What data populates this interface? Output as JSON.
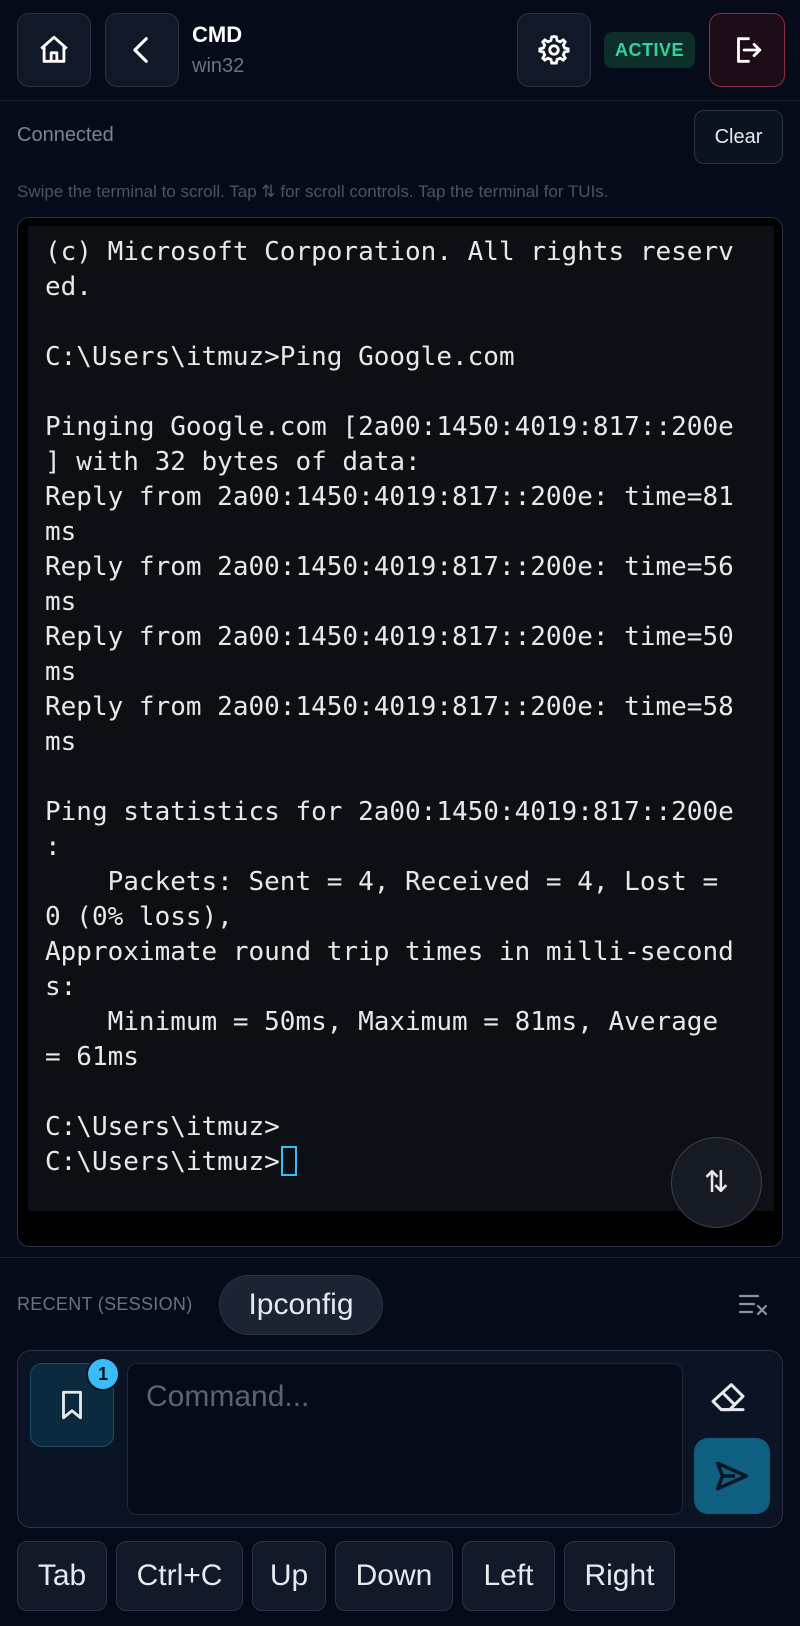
{
  "header": {
    "title": "CMD",
    "subtitle": "win32",
    "status": "ACTIVE",
    "icons": {
      "home": "home-icon",
      "back": "chevron-left-icon",
      "settings": "gear-icon",
      "exit": "logout-icon"
    }
  },
  "toolbar": {
    "connection_status": "Connected",
    "clear_label": "Clear",
    "hint": "Swipe the terminal to scroll. Tap ⇅ for scroll controls. Tap the terminal for TUIs."
  },
  "terminal": {
    "lines": [
      "(c) Microsoft Corporation. All rights reserv",
      "ed.",
      "",
      "C:\\Users\\itmuz>Ping Google.com",
      "",
      "Pinging Google.com [2a00:1450:4019:817::200e",
      "] with 32 bytes of data:",
      "Reply from 2a00:1450:4019:817::200e: time=81",
      "ms",
      "Reply from 2a00:1450:4019:817::200e: time=56",
      "ms",
      "Reply from 2a00:1450:4019:817::200e: time=50",
      "ms",
      "Reply from 2a00:1450:4019:817::200e: time=58",
      "ms",
      "",
      "Ping statistics for 2a00:1450:4019:817::200e",
      ":",
      "    Packets: Sent = 4, Received = 4, Lost =",
      "0 (0% loss),",
      "Approximate round trip times in milli-second",
      "s:",
      "    Minimum = 50ms, Maximum = 81ms, Average",
      "= 61ms",
      "",
      "C:\\Users\\itmuz>",
      "C:\\Users\\itmuz>"
    ],
    "scroll_icon": "⇅"
  },
  "recent": {
    "label": "RECENT (SESSION)",
    "items": [
      "Ipconfig"
    ]
  },
  "input": {
    "placeholder": "Command...",
    "value": "",
    "bookmark_count": "1"
  },
  "keys": [
    "Tab",
    "Ctrl+C",
    "Up",
    "Down",
    "Left",
    "Right"
  ],
  "colors": {
    "accent": "#38bdf8",
    "active": "#34d399",
    "background": "#050b18"
  }
}
